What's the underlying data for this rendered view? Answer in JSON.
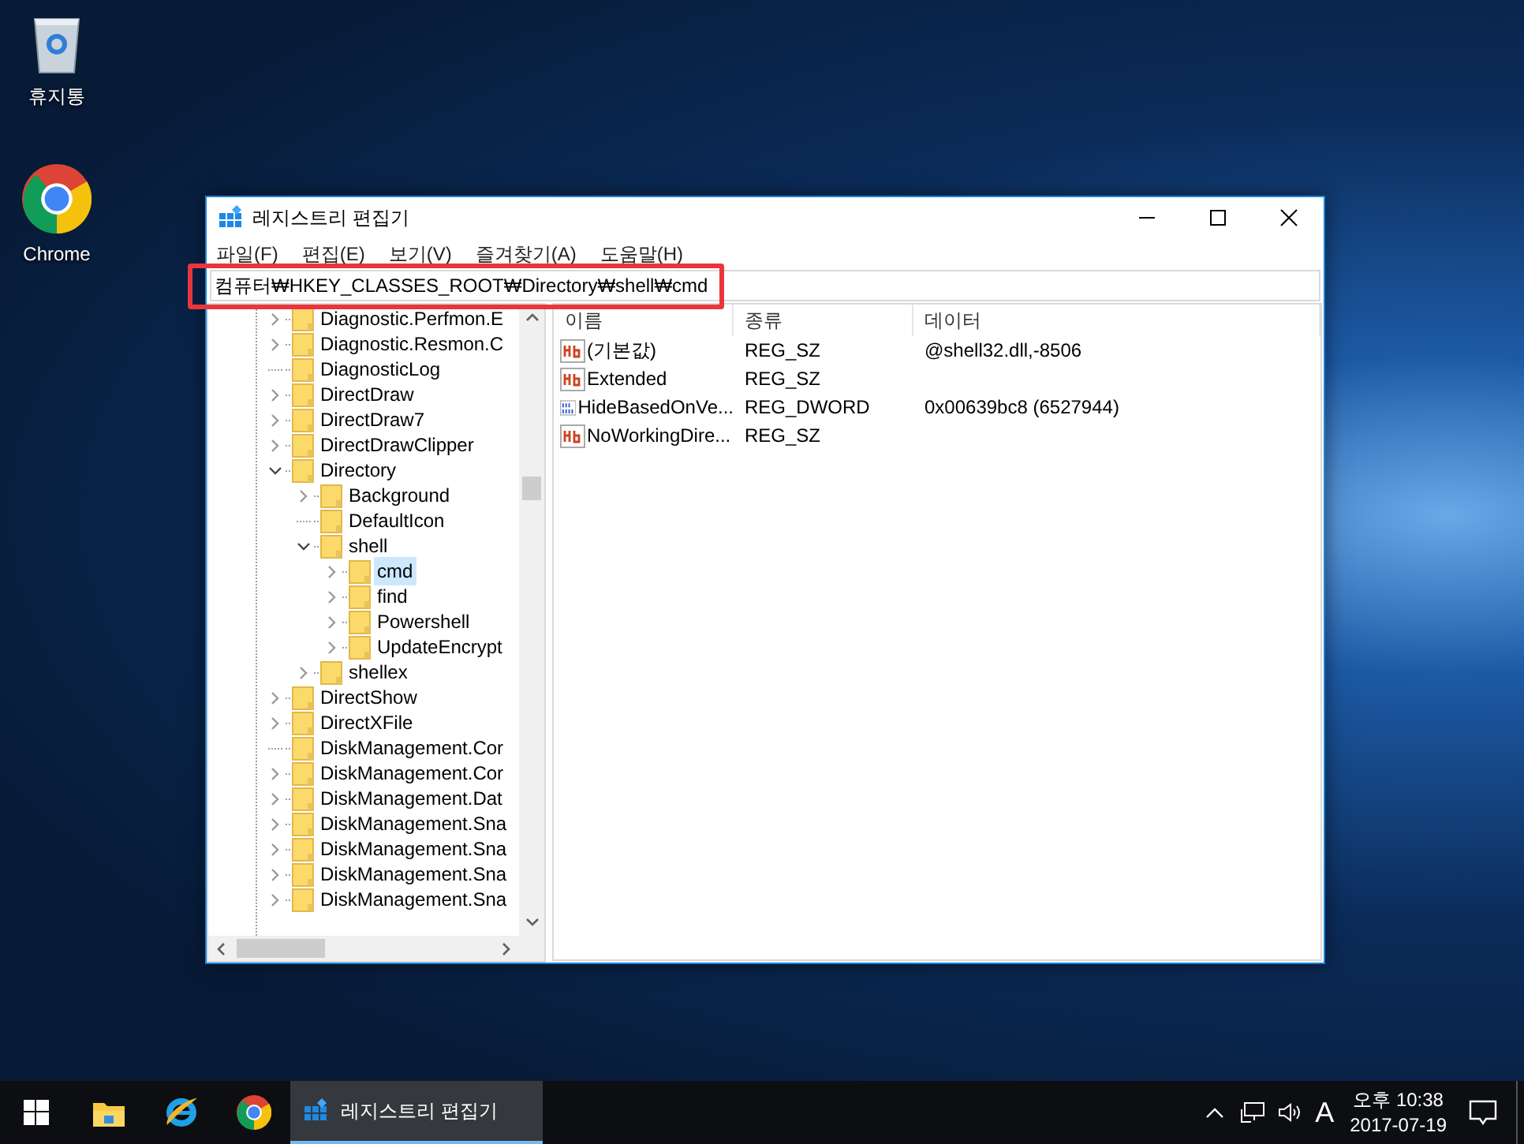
{
  "desktop_icons": [
    {
      "kind": "recycle",
      "label": "휴지통"
    },
    {
      "kind": "chrome",
      "label": "Chrome"
    }
  ],
  "window": {
    "title": "레지스트리 편집기"
  },
  "menu": [
    "파일(F)",
    "편집(E)",
    "보기(V)",
    "즐겨찾기(A)",
    "도움말(H)"
  ],
  "address": "컴퓨터₩HKEY_CLASSES_ROOT₩Directory₩shell₩cmd",
  "tree": [
    {
      "label": "Diagnostic.Perfmon.E",
      "expandable": true,
      "expanded": false,
      "selected": false
    },
    {
      "label": "Diagnostic.Resmon.C",
      "expandable": true,
      "expanded": false,
      "selected": false
    },
    {
      "label": "DiagnosticLog",
      "expandable": false,
      "selected": false
    },
    {
      "label": "DirectDraw",
      "expandable": true,
      "expanded": false,
      "selected": false
    },
    {
      "label": "DirectDraw7",
      "expandable": true,
      "expanded": false,
      "selected": false
    },
    {
      "label": "DirectDrawClipper",
      "expandable": true,
      "expanded": false,
      "selected": false
    },
    {
      "label": "Directory",
      "expandable": true,
      "expanded": true,
      "selected": false,
      "children": [
        {
          "label": "Background",
          "expandable": true,
          "expanded": false,
          "selected": false
        },
        {
          "label": "DefaultIcon",
          "expandable": false,
          "selected": false
        },
        {
          "label": "shell",
          "expandable": true,
          "expanded": true,
          "selected": false,
          "children": [
            {
              "label": "cmd",
              "expandable": true,
              "expanded": false,
              "selected": true
            },
            {
              "label": "find",
              "expandable": true,
              "expanded": false,
              "selected": false
            },
            {
              "label": "Powershell",
              "expandable": true,
              "expanded": false,
              "selected": false
            },
            {
              "label": "UpdateEncrypt",
              "expandable": true,
              "expanded": false,
              "selected": false
            }
          ]
        },
        {
          "label": "shellex",
          "expandable": true,
          "expanded": false,
          "selected": false
        }
      ]
    },
    {
      "label": "DirectShow",
      "expandable": true,
      "expanded": false,
      "selected": false
    },
    {
      "label": "DirectXFile",
      "expandable": true,
      "expanded": false,
      "selected": false
    },
    {
      "label": "DiskManagement.Cor",
      "expandable": false,
      "selected": false
    },
    {
      "label": "DiskManagement.Cor",
      "expandable": true,
      "expanded": false,
      "selected": false
    },
    {
      "label": "DiskManagement.Dat",
      "expandable": true,
      "expanded": false,
      "selected": false
    },
    {
      "label": "DiskManagement.Sna",
      "expandable": true,
      "expanded": false,
      "selected": false
    },
    {
      "label": "DiskManagement.Sna",
      "expandable": true,
      "expanded": false,
      "selected": false
    },
    {
      "label": "DiskManagement.Sna",
      "expandable": true,
      "expanded": false,
      "selected": false
    },
    {
      "label": "DiskManagement.Sna",
      "expandable": true,
      "expanded": false,
      "selected": false
    }
  ],
  "values_table": {
    "columns": [
      "이름",
      "종류",
      "데이터"
    ],
    "rows": [
      {
        "kind": "string",
        "name": "(기본값)",
        "type": "REG_SZ",
        "data": "@shell32.dll,-8506"
      },
      {
        "kind": "string",
        "name": "Extended",
        "type": "REG_SZ"
      },
      {
        "kind": "dword",
        "name": "HideBasedOnVe...",
        "type": "REG_DWORD",
        "data": "0x00639bc8 (6527944)"
      },
      {
        "kind": "string",
        "name": "NoWorkingDire...",
        "type": "REG_SZ"
      }
    ]
  },
  "taskbar": {
    "apps": [
      {
        "kind": "explorer",
        "active": false
      },
      {
        "kind": "ie",
        "active": false
      },
      {
        "kind": "chrome",
        "active": false
      },
      {
        "kind": "regedit",
        "active": true,
        "label": "레지스트리 편집기"
      }
    ],
    "tray": {
      "ime": "A",
      "time": "오후 10:38",
      "date": "2017-07-19"
    }
  }
}
